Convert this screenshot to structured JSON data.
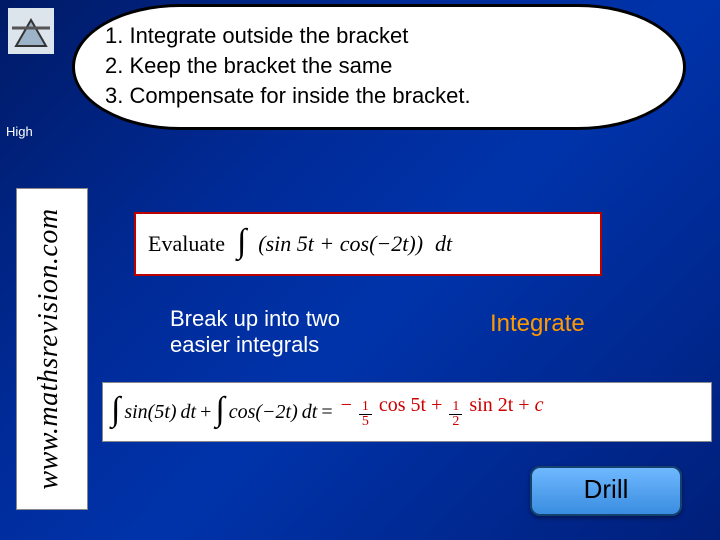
{
  "logo": {
    "name": "triangle-logo"
  },
  "callout": {
    "step1": "1. Integrate outside the bracket",
    "step2": "2. Keep the bracket the same",
    "step3": "3. Compensate for inside the bracket."
  },
  "corner_text": "High",
  "side_url": "www.mathsrevision.com",
  "evaluate": {
    "label": "Evaluate",
    "integral_symbol": "∫",
    "expr_open": "(sin 5t + cos(−2t))",
    "dt": "dt"
  },
  "hints": {
    "break_up_line1": "Break up into two",
    "break_up_line2": "easier integrals",
    "integrate": "Integrate"
  },
  "result": {
    "int1": "∫",
    "f1": "sin(5t)",
    "dt1": "dt",
    "plus": "+",
    "int2": "∫",
    "f2": "cos(−2t)",
    "dt2": "dt",
    "eq": "=",
    "term1_sign": "−",
    "term1_frac_n": "1",
    "term1_frac_d": "5",
    "term1_tail": "cos 5t",
    "term2_sign": "+",
    "term2_frac_n": "1",
    "term2_frac_d": "2",
    "term2_tail": "sin 2t",
    "const_sign": "+",
    "const": "c"
  },
  "drill_button": "Drill"
}
